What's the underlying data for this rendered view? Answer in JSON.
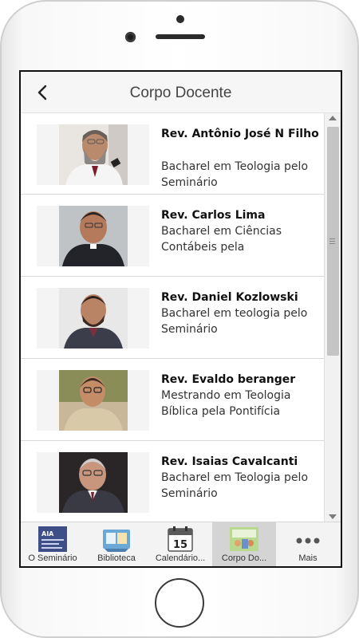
{
  "header": {
    "title": "Corpo Docente"
  },
  "faculty": [
    {
      "name": "Rev. Antônio José N Filho",
      "description": "Bacharel em Teologia pelo Seminário",
      "photo_icon": "photo-bearded-man"
    },
    {
      "name": "Rev. Carlos Lima",
      "description": "Bacharel em Ciências Contábeis pela",
      "photo_icon": "photo-man-clerical-collar"
    },
    {
      "name": "Rev. Daniel Kozlowski",
      "description": "Bacharel em teologia pelo Seminário",
      "photo_icon": "photo-man-beard"
    },
    {
      "name": "Rev. Evaldo beranger",
      "description": "Mestrando em Teologia Bíblica pela Pontifícia",
      "photo_icon": "photo-man-glasses"
    },
    {
      "name": "Rev. Isaias Cavalcanti",
      "description": "Bacharel em Teologia pelo Seminário",
      "photo_icon": "photo-older-man-glasses"
    }
  ],
  "tabs": [
    {
      "label": "O Seminário",
      "icon": "seminary-logo-icon",
      "active": false
    },
    {
      "label": "Biblioteca",
      "icon": "library-icon",
      "active": false
    },
    {
      "label": "Calendário...",
      "icon": "calendar-icon",
      "active": false
    },
    {
      "label": "Corpo Do...",
      "icon": "faculty-icon",
      "active": true
    },
    {
      "label": "Mais",
      "icon": "more-icon",
      "active": false
    }
  ],
  "calendar_icon_text": "15",
  "colors": {
    "active_tab": "#d4d4d4",
    "header_bg": "#f6f6f6",
    "text": "#111111"
  }
}
